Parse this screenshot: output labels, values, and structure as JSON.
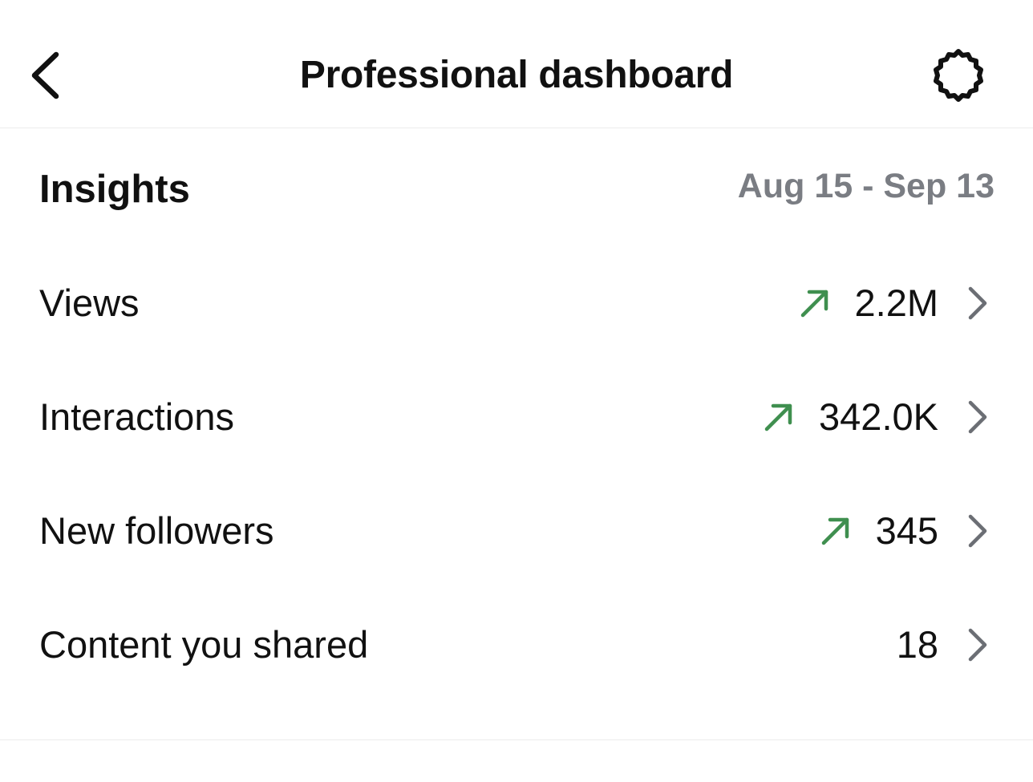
{
  "header": {
    "back_icon": "chevron-left-icon",
    "title": "Professional dashboard",
    "settings_icon": "gear-icon"
  },
  "insights": {
    "title": "Insights",
    "date_range": "Aug 15 - Sep 13",
    "metrics": [
      {
        "label": "Views",
        "value": "2.2M",
        "trend": "up"
      },
      {
        "label": "Interactions",
        "value": "342.0K",
        "trend": "up"
      },
      {
        "label": "New followers",
        "value": "345",
        "trend": "up"
      },
      {
        "label": "Content you shared",
        "value": "18",
        "trend": null
      }
    ]
  },
  "colors": {
    "trend_up": "#3f8f4f",
    "secondary_text": "#7a7d83",
    "chevron": "#6b6e74",
    "divider": "#ececec"
  }
}
